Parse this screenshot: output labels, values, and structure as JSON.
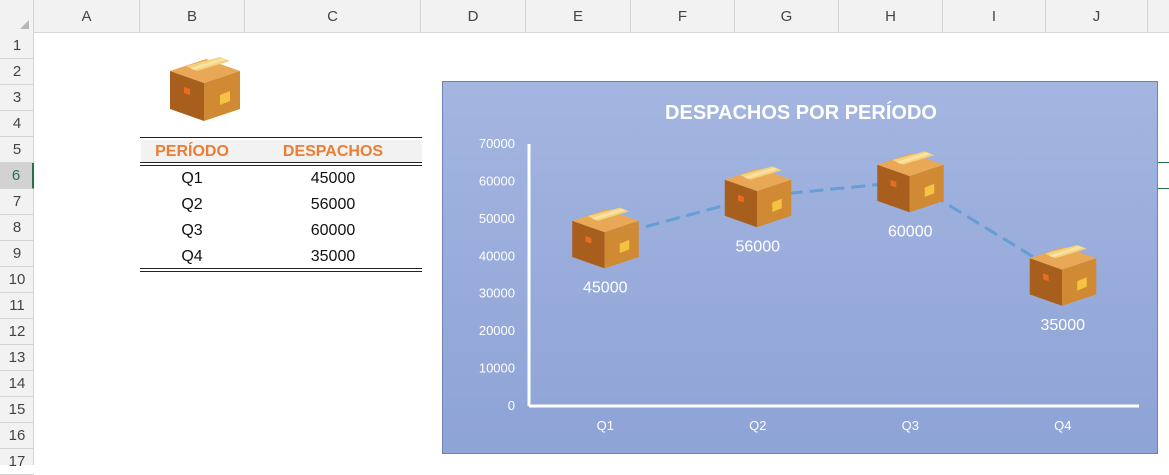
{
  "columns": [
    "A",
    "B",
    "C",
    "D",
    "E",
    "F",
    "G",
    "H",
    "I",
    "J"
  ],
  "rows": [
    "1",
    "2",
    "3",
    "4",
    "5",
    "6",
    "7",
    "8",
    "9",
    "10",
    "11",
    "12",
    "13",
    "14",
    "15",
    "16",
    "17"
  ],
  "selected_row": "6",
  "table": {
    "headers": [
      "PERÍODO",
      "DESPACHOS"
    ],
    "rows": [
      {
        "period": "Q1",
        "value": "45000"
      },
      {
        "period": "Q2",
        "value": "56000"
      },
      {
        "period": "Q3",
        "value": "60000"
      },
      {
        "period": "Q4",
        "value": "35000"
      }
    ]
  },
  "icons": {
    "table_icon": "box-icon",
    "chart_markers": "box-icon"
  },
  "colors": {
    "accent": "#ed7d31",
    "chart_bg": "#9aadda",
    "box_main": "#c97d2a",
    "box_tape": "#f5c242",
    "selection": "#217346"
  },
  "chart_data": {
    "type": "line",
    "title": "DESPACHOS POR PERÍODO",
    "categories": [
      "Q1",
      "Q2",
      "Q3",
      "Q4"
    ],
    "values": [
      45000,
      56000,
      60000,
      35000
    ],
    "ylim": [
      0,
      70000
    ],
    "yticks": [
      "0",
      "10000",
      "20000",
      "30000",
      "40000",
      "50000",
      "60000",
      "70000"
    ],
    "data_labels": [
      "45000",
      "56000",
      "60000",
      "35000"
    ],
    "xlabel": "",
    "ylabel": "",
    "grid": false,
    "line_style": "dashed",
    "marker": "box-icon"
  }
}
